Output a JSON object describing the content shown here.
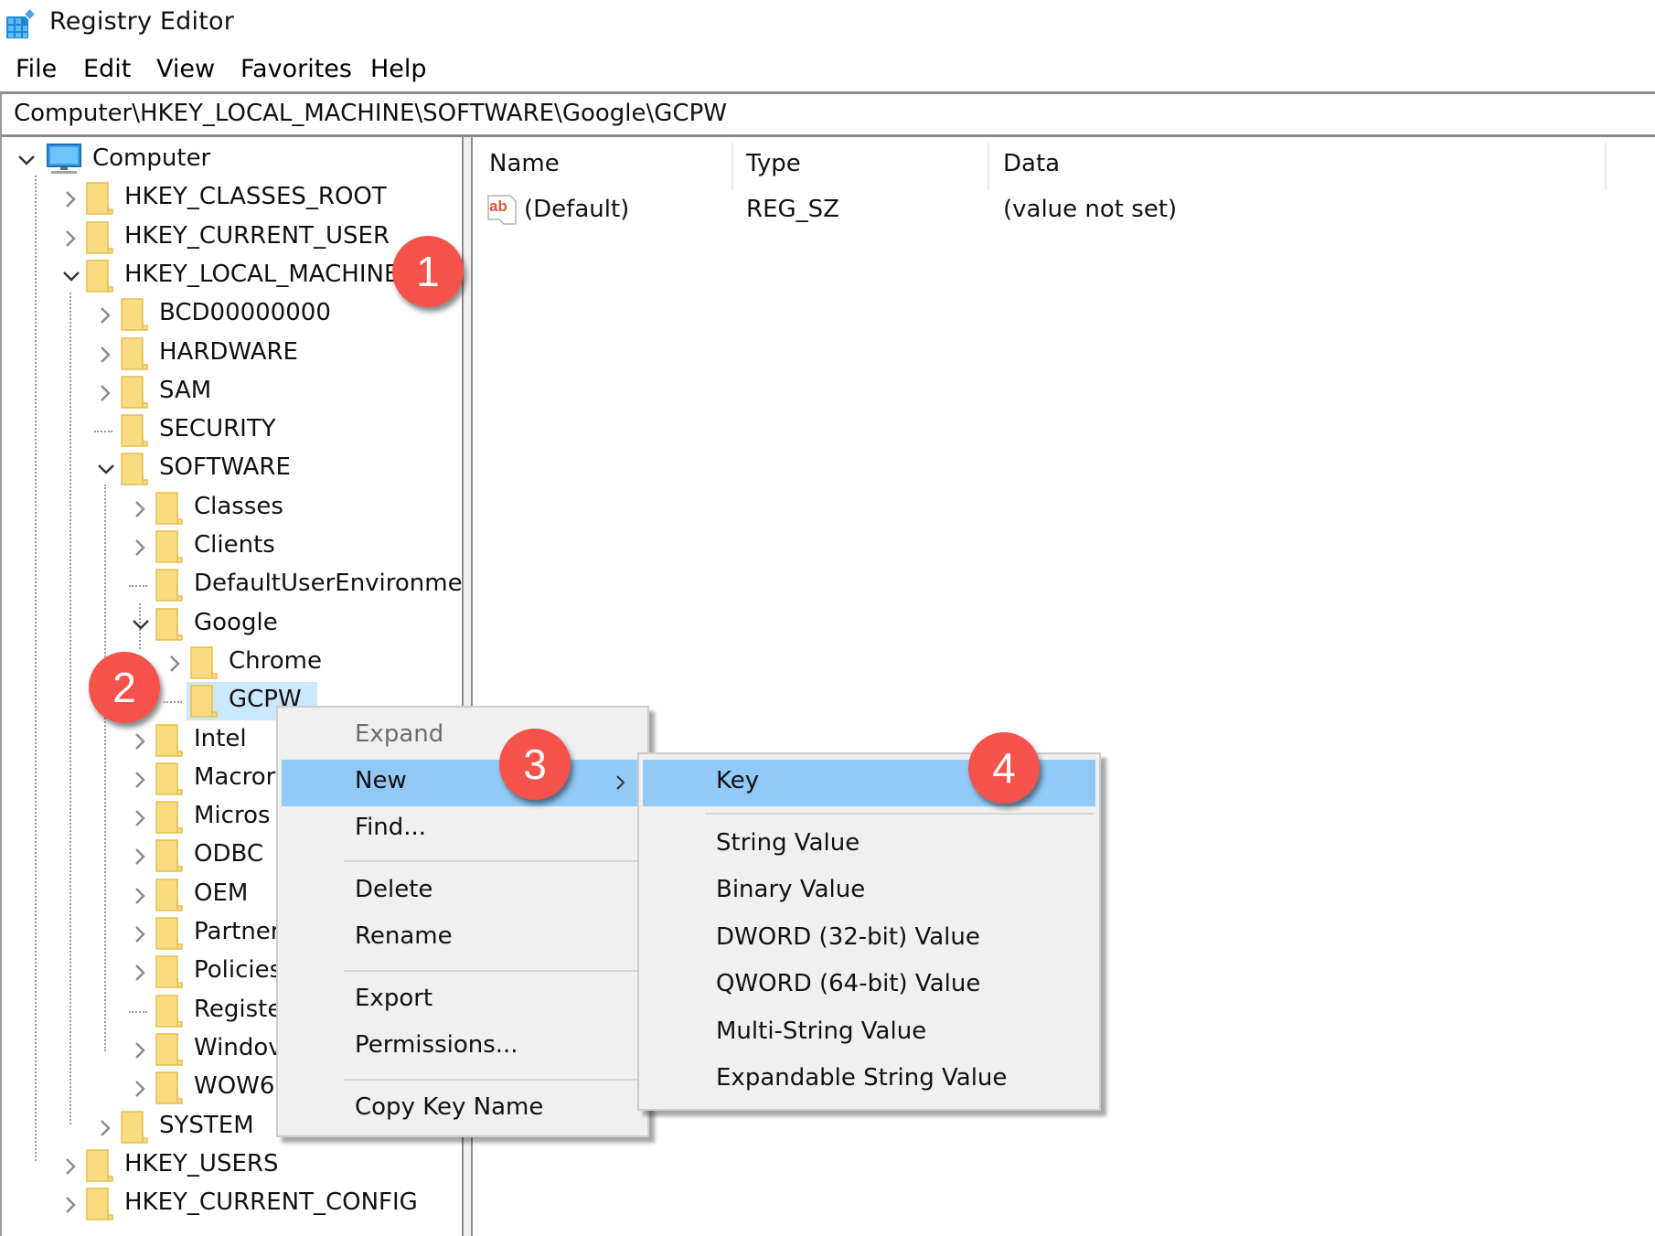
{
  "window": {
    "title": "Registry Editor",
    "icon": "registry-editor-icon"
  },
  "menubar": {
    "items": [
      "File",
      "Edit",
      "View",
      "Favorites",
      "Help"
    ]
  },
  "address_bar": {
    "path": "Computer\\HKEY_LOCAL_MACHINE\\SOFTWARE\\Google\\GCPW"
  },
  "tree": {
    "root": "Computer",
    "nodes": [
      {
        "label": "HKEY_CLASSES_ROOT",
        "state": "collapsed"
      },
      {
        "label": "HKEY_CURRENT_USER",
        "state": "collapsed"
      },
      {
        "label": "HKEY_LOCAL_MACHINE",
        "state": "expanded"
      },
      {
        "label": "BCD00000000",
        "state": "collapsed"
      },
      {
        "label": "HARDWARE",
        "state": "collapsed"
      },
      {
        "label": "SAM",
        "state": "collapsed"
      },
      {
        "label": "SECURITY",
        "state": "leaf"
      },
      {
        "label": "SOFTWARE",
        "state": "expanded"
      },
      {
        "label": "Classes",
        "state": "collapsed"
      },
      {
        "label": "Clients",
        "state": "collapsed"
      },
      {
        "label": "DefaultUserEnvironmen",
        "state": "leaf"
      },
      {
        "label": "Google",
        "state": "expanded"
      },
      {
        "label": "Chrome",
        "state": "collapsed"
      },
      {
        "label": "GCPW",
        "state": "selected"
      },
      {
        "label": "Intel",
        "state": "collapsed"
      },
      {
        "label": "Macror",
        "state": "collapsed"
      },
      {
        "label": "Micros",
        "state": "collapsed"
      },
      {
        "label": "ODBC",
        "state": "collapsed"
      },
      {
        "label": "OEM",
        "state": "collapsed"
      },
      {
        "label": "Partner",
        "state": "collapsed"
      },
      {
        "label": "Policies",
        "state": "collapsed"
      },
      {
        "label": "Registe",
        "state": "leaf"
      },
      {
        "label": "Windov",
        "state": "collapsed"
      },
      {
        "label": "WOW6",
        "state": "collapsed"
      },
      {
        "label": "SYSTEM",
        "state": "collapsed"
      },
      {
        "label": "HKEY_USERS",
        "state": "collapsed"
      },
      {
        "label": "HKEY_CURRENT_CONFIG",
        "state": "collapsed"
      }
    ]
  },
  "list": {
    "columns": [
      "Name",
      "Type",
      "Data"
    ],
    "rows": [
      {
        "name": "(Default)",
        "type": "REG_SZ",
        "data": "(value not set)",
        "icon": "string-value-icon"
      }
    ]
  },
  "context_menu": {
    "items": [
      {
        "label": "Expand",
        "disabled": true
      },
      {
        "label": "New",
        "highlighted": true,
        "submenu": true
      },
      {
        "label": "Find..."
      },
      {
        "label": "Delete"
      },
      {
        "label": "Rename"
      },
      {
        "label": "Export"
      },
      {
        "label": "Permissions..."
      },
      {
        "label": "Copy Key Name"
      }
    ]
  },
  "submenu": {
    "items": [
      {
        "label": "Key",
        "highlighted": true
      },
      {
        "label": "String Value"
      },
      {
        "label": "Binary Value"
      },
      {
        "label": "DWORD (32-bit) Value"
      },
      {
        "label": "QWORD (64-bit) Value"
      },
      {
        "label": "Multi-String Value"
      },
      {
        "label": "Expandable String Value"
      }
    ]
  },
  "annotations": [
    "1",
    "2",
    "3",
    "4"
  ],
  "colors": {
    "selection": "#cce8ff",
    "menu_highlight": "#91c9f7",
    "menu_bg": "#f0f0f0",
    "badge": "#f4524a",
    "folder": "#f8d775"
  }
}
